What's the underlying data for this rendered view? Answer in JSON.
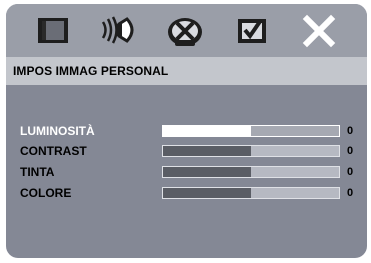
{
  "tabs": [
    {
      "icon": "tv-screen-icon"
    },
    {
      "icon": "speaker-icon"
    },
    {
      "icon": "disc-icon"
    },
    {
      "icon": "preferences-check-icon"
    },
    {
      "icon": "close-icon"
    }
  ],
  "header": {
    "title": "IMPOS IMMAG PERSONAL"
  },
  "settings": [
    {
      "label": "LUMINOSITÀ",
      "value": "0",
      "level": 0.5,
      "active": true
    },
    {
      "label": "CONTRAST",
      "value": "0",
      "level": 0.5,
      "active": false
    },
    {
      "label": "TINTA",
      "value": "0",
      "level": 0.5,
      "active": false
    },
    {
      "label": "COLORE",
      "value": "0",
      "level": 0.5,
      "active": false
    }
  ],
  "colors": {
    "panel": "#848895",
    "bar_fill": "#5a5d65",
    "bar_track": "#b6b9c2",
    "highlight": "#ffffff"
  }
}
